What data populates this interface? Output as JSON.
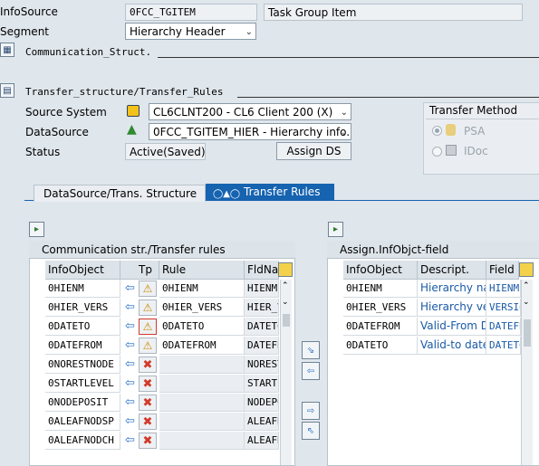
{
  "header": {
    "infosource_label": "InfoSource",
    "infosource_value": "0FCC_TGITEM",
    "infosource_desc": "Task Group Item",
    "segment_label": "Segment",
    "segment_value": "Hierarchy Header",
    "comm_struct_label": "Communication_Struct.",
    "transfer_label": "Transfer_structure/Transfer_Rules"
  },
  "source": {
    "source_system_label": "Source System",
    "source_system_value": "CL6CLNT200 - CL6 Client 200 (X)",
    "datasource_label": "DataSource",
    "datasource_value": "0FCC_TGITEM_HIER - Hierarchy info...",
    "status_label": "Status",
    "status_value": "Active(Saved)",
    "assign_ds_label": "Assign DS"
  },
  "transfer_method": {
    "title": "Transfer Method",
    "psa_label": "PSA",
    "idoc_label": "IDoc"
  },
  "tabs": [
    {
      "label": "DataSource/Trans. Structure"
    },
    {
      "label": "Transfer Rules"
    }
  ],
  "left_panel": {
    "title": "Communication str./Transfer rules",
    "columns": [
      "InfoObject",
      "Tp",
      "Rule",
      "FldNa"
    ],
    "rows": [
      {
        "infoobject": "0HIENM",
        "rule": "0HIENM",
        "field": "HIENM",
        "type": "assign"
      },
      {
        "infoobject": "0HIER_VERS",
        "rule": "0HIER_VERS",
        "field": "HIER_VERS",
        "type": "assign"
      },
      {
        "infoobject": "0DATETO",
        "rule": "0DATETO",
        "field": "DATETO",
        "type": "assign"
      },
      {
        "infoobject": "0DATEFROM",
        "rule": "0DATEFROM",
        "field": "DATEFROM",
        "type": "assign"
      },
      {
        "infoobject": "0NORESTNODE",
        "rule": "",
        "field": "NORESTNODE",
        "type": "none"
      },
      {
        "infoobject": "0STARTLEVEL",
        "rule": "",
        "field": "STARTLEVEL",
        "type": "none"
      },
      {
        "infoobject": "0NODEPOSIT",
        "rule": "",
        "field": "NODEPOSIT",
        "type": "none"
      },
      {
        "infoobject": "0ALEAFNODSP",
        "rule": "",
        "field": "ALEAFNODSP",
        "type": "none"
      },
      {
        "infoobject": "0ALEAFNODCH",
        "rule": "",
        "field": "ALEAFNODCH",
        "type": "none"
      }
    ]
  },
  "right_panel": {
    "title": "Assign.InfObjct-field",
    "columns": [
      "InfoObject",
      "Descript.",
      "Field"
    ],
    "rows": [
      {
        "infoobject": "0HIENM",
        "descript": "Hierarchy na...",
        "field": "HIENM"
      },
      {
        "infoobject": "0HIER_VERS",
        "descript": "Hierarchy ve...",
        "field": "VERSION"
      },
      {
        "infoobject": "0DATEFROM",
        "descript": "Valid-From D...",
        "field": "DATEFROM"
      },
      {
        "infoobject": "0DATETO",
        "descript": "Valid-to date",
        "field": "DATETO"
      }
    ]
  },
  "colors": {
    "background": "#dfe6ec",
    "tab_active": "#1663b0",
    "link": "#1a5aa6",
    "delete_red": "#d23a2a",
    "arrow_blue": "#2a72c8"
  }
}
